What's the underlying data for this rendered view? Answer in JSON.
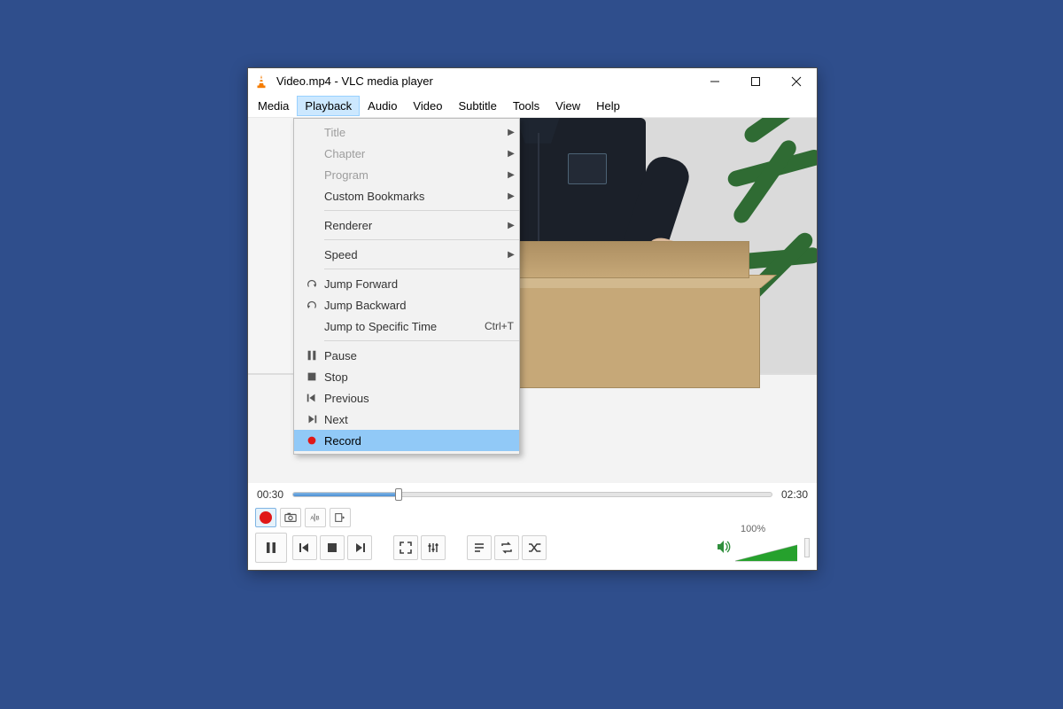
{
  "titlebar": {
    "title": "Video.mp4 - VLC media player"
  },
  "menubar": {
    "items": [
      {
        "label": "Media"
      },
      {
        "label": "Playback",
        "active": true
      },
      {
        "label": "Audio"
      },
      {
        "label": "Video"
      },
      {
        "label": "Subtitle"
      },
      {
        "label": "Tools"
      },
      {
        "label": "View"
      },
      {
        "label": "Help"
      }
    ]
  },
  "dropdown": {
    "groups": [
      [
        {
          "label": "Title",
          "disabled": true,
          "submenu": true
        },
        {
          "label": "Chapter",
          "disabled": true,
          "submenu": true
        },
        {
          "label": "Program",
          "disabled": true,
          "submenu": true
        },
        {
          "label": "Custom Bookmarks",
          "submenu": true
        }
      ],
      [
        {
          "label": "Renderer",
          "submenu": true
        }
      ],
      [
        {
          "label": "Speed",
          "submenu": true
        }
      ],
      [
        {
          "label": "Jump Forward",
          "icon": "jump-forward"
        },
        {
          "label": "Jump Backward",
          "icon": "jump-backward"
        },
        {
          "label": "Jump to Specific Time",
          "shortcut": "Ctrl+T"
        }
      ],
      [
        {
          "label": "Pause",
          "icon": "pause"
        },
        {
          "label": "Stop",
          "icon": "stop"
        },
        {
          "label": "Previous",
          "icon": "prev"
        },
        {
          "label": "Next",
          "icon": "next"
        },
        {
          "label": "Record",
          "icon": "record",
          "highlight": true
        }
      ]
    ]
  },
  "timeline": {
    "elapsed": "00:30",
    "total": "02:30"
  },
  "volume": {
    "percent": "100%"
  }
}
